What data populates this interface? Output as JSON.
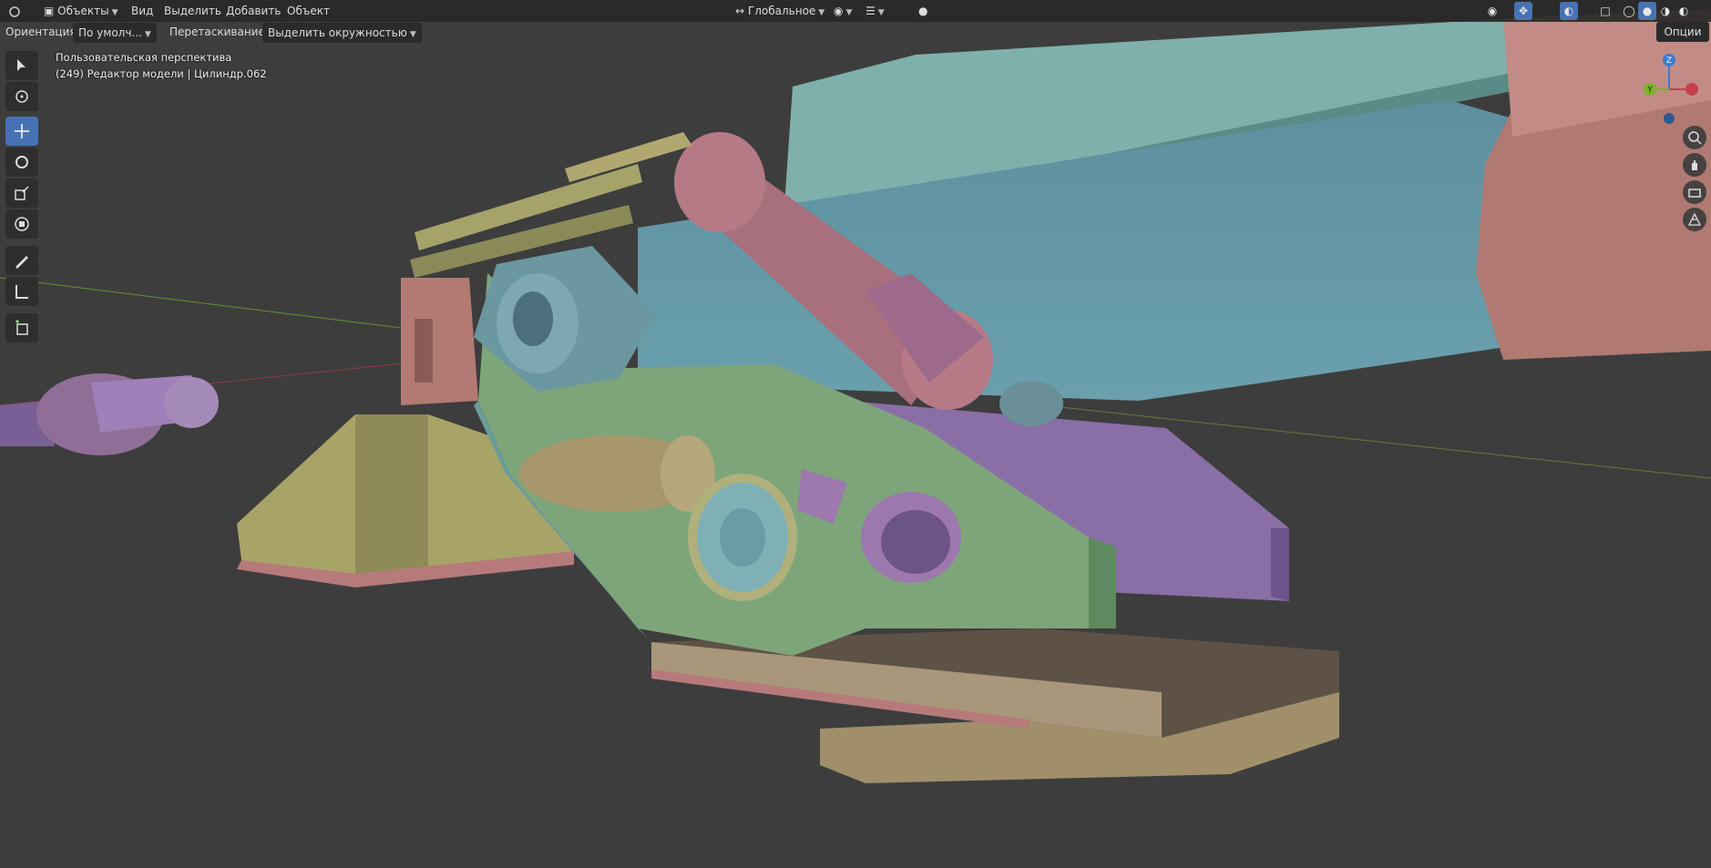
{
  "header": {
    "mode_label": "Объекты",
    "menu": [
      "Вид",
      "Выделить",
      "Добавить",
      "Объект"
    ],
    "transform_orientation": "Глобальное"
  },
  "subheader": {
    "orientation_label": "Ориентация:",
    "orientation_value": "По умолч...",
    "drag_label": "Перетаскивание:",
    "drag_value": "Выделить окружностью"
  },
  "overlay_info": {
    "view_name": "Пользовательская перспектива",
    "object_info": "(249) Редактор модели | Цилиндр.062"
  },
  "options_label": "Опции",
  "gizmo": {
    "z_label": "Z",
    "y_label": "Y"
  },
  "toolbar": {
    "tools": [
      {
        "name": "select-box",
        "icon": "cursor-icon"
      },
      {
        "name": "cursor",
        "icon": "crosshair-icon"
      },
      {
        "name": "move",
        "icon": "move-icon",
        "active": true
      },
      {
        "name": "rotate",
        "icon": "rotate-icon"
      },
      {
        "name": "scale",
        "icon": "scale-icon"
      },
      {
        "name": "transform",
        "icon": "transform-icon"
      },
      {
        "name": "annotate",
        "icon": "annotate-icon"
      },
      {
        "name": "measure",
        "icon": "measure-icon"
      },
      {
        "name": "add-cube",
        "icon": "add-cube-icon"
      }
    ]
  },
  "colors": {
    "viewport_bg": "#3d3d3d",
    "active_tool": "#4772b3",
    "axis_x": "#c8404e",
    "axis_y": "#7db32a",
    "axis_z": "#3d7bd1"
  }
}
